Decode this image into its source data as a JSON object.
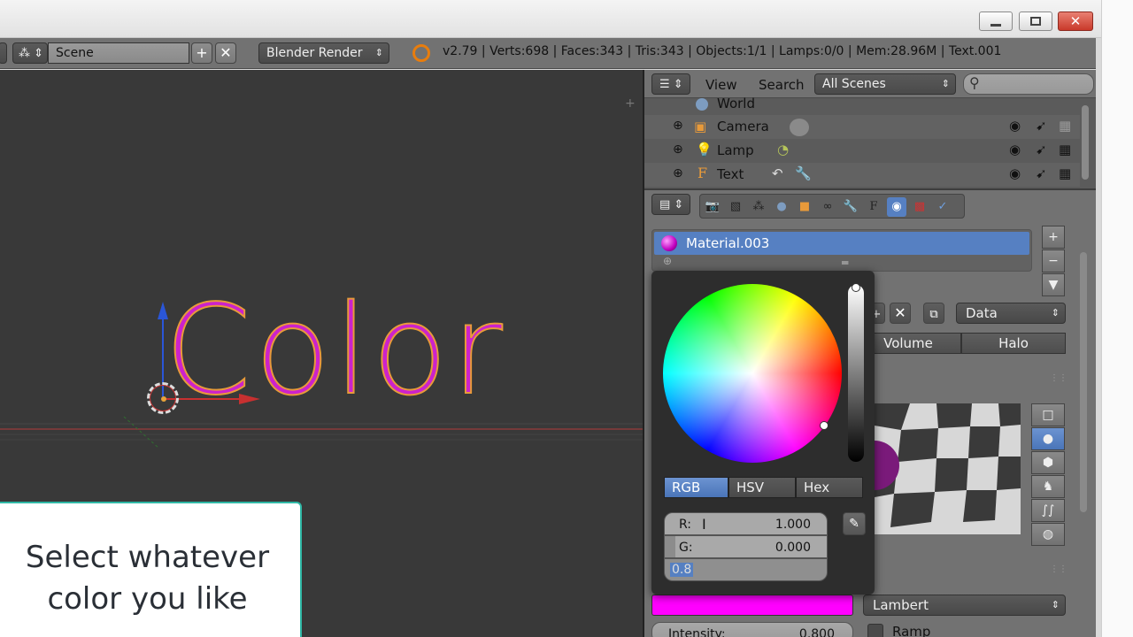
{
  "window": {
    "minimize_icon": "minimize-icon",
    "maximize_icon": "maximize-icon",
    "close_icon": "close-icon"
  },
  "header": {
    "scene_name": "Scene",
    "render_engine": "Blender Render",
    "stats": "v2.79 | Verts:698 | Faces:343 | Tris:343 | Objects:1/1 | Lamps:0/0 | Mem:28.96M | Text.001"
  },
  "viewport": {
    "text_object": "Color",
    "text_color": "#cc22cc"
  },
  "caption": {
    "line1": "Select whatever",
    "line2": "color you like"
  },
  "outliner": {
    "menu_view": "View",
    "menu_search": "Search",
    "filter": "All Scenes",
    "items": [
      {
        "label": "World"
      },
      {
        "label": "Camera"
      },
      {
        "label": "Lamp"
      },
      {
        "label": "Text"
      }
    ]
  },
  "properties": {
    "material_name": "Material.003",
    "data_dropdown": "Data",
    "tab_volume": "Volume",
    "tab_halo": "Halo",
    "diffuse_color": "#ff00ff",
    "shader": "Lambert",
    "intensity_label": "Intensity:",
    "intensity_value": "0.800",
    "ramp_label": "Ramp"
  },
  "color_picker": {
    "modes": [
      "RGB",
      "HSV",
      "Hex"
    ],
    "active_mode": "RGB",
    "r_label": "R:",
    "r_value": "1.000",
    "g_label": "G:",
    "g_value": "0.000",
    "b_editing": "0.8"
  }
}
